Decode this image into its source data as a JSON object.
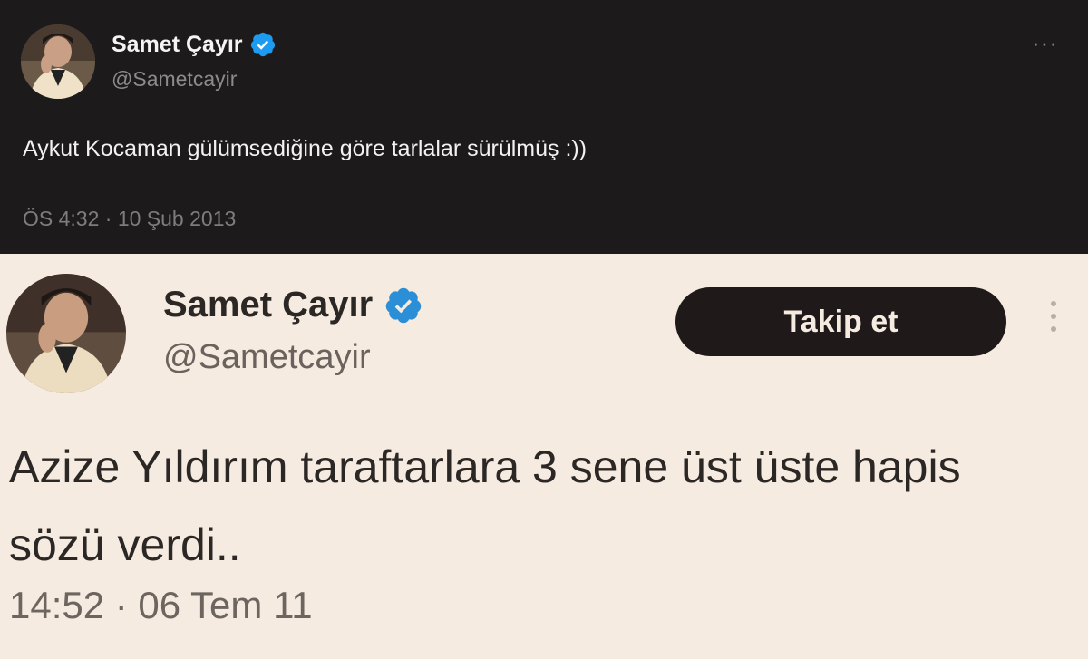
{
  "tweets": [
    {
      "theme": "dark",
      "background": "#1c1a1b",
      "author": {
        "display_name": "Samet Çayır",
        "handle": "@Sametcayir",
        "verified": true
      },
      "more_icon": "more-horizontal-icon",
      "text": "Aykut Kocaman gülümsediğine göre tarlalar sürülmüş :))",
      "timestamp": "ÖS 4:32 · 10 Şub 2013"
    },
    {
      "theme": "light",
      "background": "#f6ebe0",
      "author": {
        "display_name": "Samet Çayır",
        "handle": "@Sametcayir",
        "verified": true
      },
      "follow_label": "Takip et",
      "more_icon": "more-vertical-icon",
      "text": "Azize Yıldırım taraftarlara 3 sene üst üste hapis sözü verdi..",
      "timestamp": "14:52 · 06 Tem 11"
    }
  ],
  "colors": {
    "verified_badge": "#1d9bf0",
    "follow_button": "#1f1a19"
  }
}
